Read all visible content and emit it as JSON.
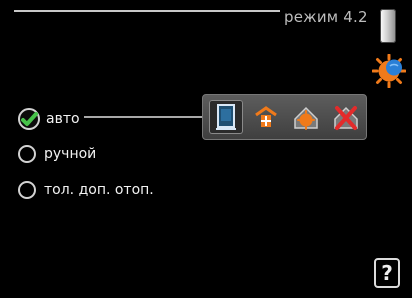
{
  "header": {
    "title": "режим 4.2"
  },
  "options": [
    {
      "label": "авто",
      "selected": true
    },
    {
      "label": "ручной",
      "selected": false
    },
    {
      "label": "тол. доп. отоп.",
      "selected": false
    }
  ],
  "iconbar": {
    "icons": [
      "heating-unit-icon",
      "house-heating-icon",
      "hot-water-icon",
      "cooling-off-icon"
    ],
    "selected_index": 0
  },
  "help": {
    "label": "?"
  },
  "colors": {
    "check_green": "#47c24a",
    "accent_orange": "#f07a1a",
    "red_x": "#e32b2b",
    "blue": "#2a7fd6"
  }
}
